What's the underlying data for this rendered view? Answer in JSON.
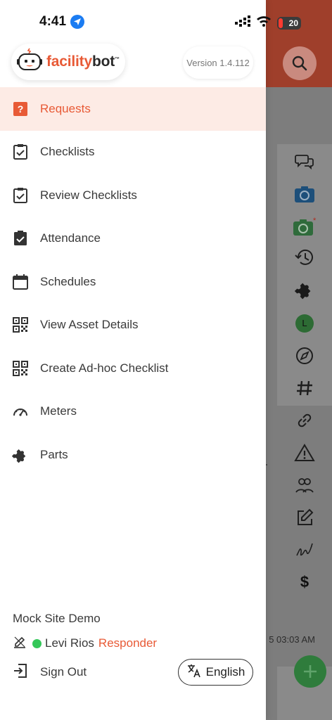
{
  "status_bar": {
    "time": "4:41",
    "battery": "20"
  },
  "drawer": {
    "logo_part1": "facility",
    "logo_part2": "bot",
    "logo_tm": "™",
    "version": "Version 1.4.112",
    "menu": [
      {
        "label": "Requests",
        "icon": "question-square-icon",
        "active": true
      },
      {
        "label": "Checklists",
        "icon": "clipboard-check-icon",
        "active": false
      },
      {
        "label": "Review Checklists",
        "icon": "clipboard-check-icon",
        "active": false
      },
      {
        "label": "Attendance",
        "icon": "clipboard-check-filled-icon",
        "active": false
      },
      {
        "label": "Schedules",
        "icon": "calendar-icon",
        "active": false
      },
      {
        "label": "View Asset Details",
        "icon": "qr-code-icon",
        "active": false
      },
      {
        "label": "Create Ad-hoc Checklist",
        "icon": "qr-code-icon",
        "active": false
      },
      {
        "label": "Meters",
        "icon": "gauge-icon",
        "active": false
      },
      {
        "label": "Parts",
        "icon": "puzzle-icon",
        "active": false
      }
    ],
    "footer": {
      "site_name": "Mock Site Demo",
      "user_name": "Levi Rios",
      "user_role": "Responder",
      "sign_out": "Sign Out",
      "language": "English"
    }
  },
  "background": {
    "timestamp_fragment": "5 03:03 AM",
    "avatar_letter": "L"
  },
  "colors": {
    "accent": "#e85a36",
    "active_bg": "#fdebe5",
    "online": "#34c759"
  }
}
